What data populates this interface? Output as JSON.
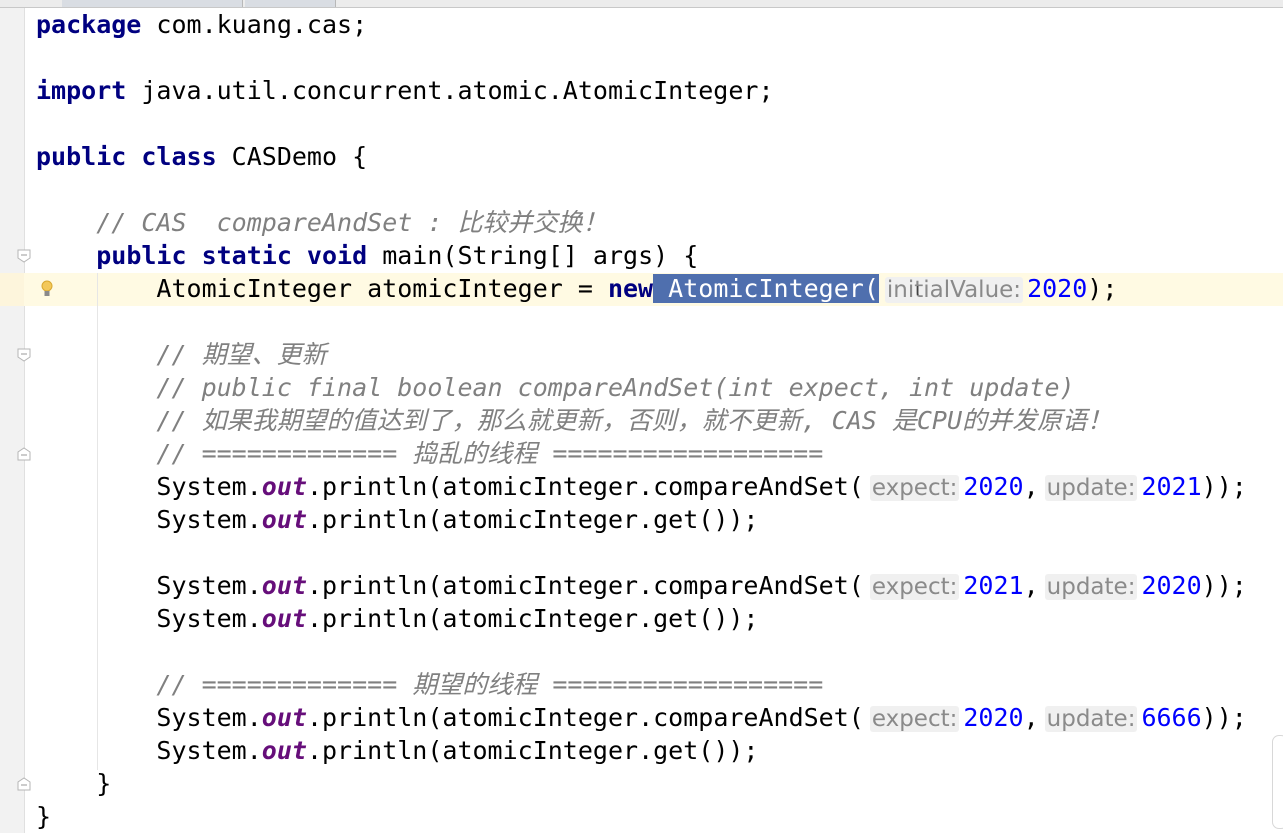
{
  "editor": {
    "language": "java",
    "colors": {
      "keyword": "#000080",
      "comment": "#808080",
      "number": "#0000ff",
      "static_field": "#660e7a",
      "selection": "#4f6fae",
      "current_line": "#fffae3"
    },
    "lines": [
      [
        {
          "t": "package",
          "c": "kw"
        },
        {
          "t": " com.kuang.cas;"
        }
      ],
      [],
      [
        {
          "t": "import",
          "c": "kw"
        },
        {
          "t": " java.util.concurrent.atomic.AtomicInteger;"
        }
      ],
      [],
      [
        {
          "t": "public class",
          "c": "kw"
        },
        {
          "t": " CASDemo {"
        }
      ],
      [],
      [
        {
          "t": "    "
        },
        {
          "t": "// CAS  compareAndSet : 比较并交换！",
          "c": "cm"
        }
      ],
      [
        {
          "t": "    "
        },
        {
          "t": "public static void",
          "c": "kw"
        },
        {
          "t": " main(String[] args) {"
        }
      ],
      [
        {
          "t": "        AtomicInteger atomicInteger = "
        },
        {
          "t": "new",
          "c": "kw"
        },
        {
          "t": " AtomicInteger(",
          "c": "sel"
        },
        {
          "t": "initialValue:",
          "c": "hint"
        },
        {
          "t": "2020",
          "c": "num"
        },
        {
          "t": ");"
        }
      ],
      [],
      [
        {
          "t": "        "
        },
        {
          "t": "// 期望、更新",
          "c": "cm"
        }
      ],
      [
        {
          "t": "        "
        },
        {
          "t": "// public final boolean compareAndSet(int expect, int update)",
          "c": "cm"
        }
      ],
      [
        {
          "t": "        "
        },
        {
          "t": "// 如果我期望的值达到了，那么就更新，否则，就不更新, CAS 是CPU的并发原语！",
          "c": "cm"
        }
      ],
      [
        {
          "t": "        "
        },
        {
          "t": "// ============= 捣乱的线程 ==================",
          "c": "cm"
        }
      ],
      [
        {
          "t": "        System."
        },
        {
          "t": "out",
          "c": "fld"
        },
        {
          "t": ".println(atomicInteger.compareAndSet("
        },
        {
          "t": "expect:",
          "c": "hint"
        },
        {
          "t": "2020",
          "c": "num"
        },
        {
          "t": ","
        },
        {
          "t": "update:",
          "c": "hint"
        },
        {
          "t": "2021",
          "c": "num"
        },
        {
          "t": "));"
        }
      ],
      [
        {
          "t": "        System."
        },
        {
          "t": "out",
          "c": "fld"
        },
        {
          "t": ".println(atomicInteger.get());"
        }
      ],
      [],
      [
        {
          "t": "        System."
        },
        {
          "t": "out",
          "c": "fld"
        },
        {
          "t": ".println(atomicInteger.compareAndSet("
        },
        {
          "t": "expect:",
          "c": "hint"
        },
        {
          "t": "2021",
          "c": "num"
        },
        {
          "t": ","
        },
        {
          "t": "update:",
          "c": "hint"
        },
        {
          "t": "2020",
          "c": "num"
        },
        {
          "t": "));"
        }
      ],
      [
        {
          "t": "        System."
        },
        {
          "t": "out",
          "c": "fld"
        },
        {
          "t": ".println(atomicInteger.get());"
        }
      ],
      [],
      [
        {
          "t": "        "
        },
        {
          "t": "// ============= 期望的线程 ==================",
          "c": "cm"
        }
      ],
      [
        {
          "t": "        System."
        },
        {
          "t": "out",
          "c": "fld"
        },
        {
          "t": ".println(atomicInteger.compareAndSet("
        },
        {
          "t": "expect:",
          "c": "hint"
        },
        {
          "t": "2020",
          "c": "num"
        },
        {
          "t": ","
        },
        {
          "t": "update:",
          "c": "hint"
        },
        {
          "t": "6666",
          "c": "num"
        },
        {
          "t": "));"
        }
      ],
      [
        {
          "t": "        System."
        },
        {
          "t": "out",
          "c": "fld"
        },
        {
          "t": ".println(atomicInteger.get());"
        }
      ],
      [
        {
          "t": "    }"
        }
      ],
      [
        {
          "t": "}"
        }
      ]
    ],
    "gutter_icons": {
      "intention": "lightbulb-icon",
      "fold": "fold-marker-icon"
    }
  }
}
